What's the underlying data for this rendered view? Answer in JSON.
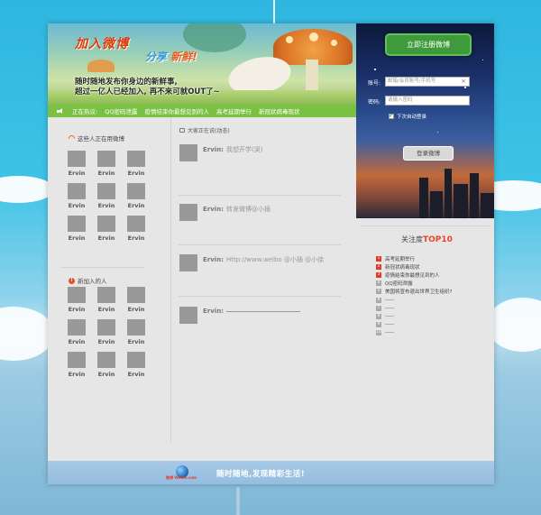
{
  "banner": {
    "title_main": "加入微博",
    "title_sub": "分享",
    "title_sub_highlight": "新鲜!",
    "line1": "随时随地发布你身边的新鲜事,",
    "line2": "超过一亿人已经加入,   再不来可就OUT了~"
  },
  "hotbar": {
    "label": "正在热议:",
    "topics": [
      "QQ密码泄露",
      "疫情结束你最想见到的人",
      "高考延期举行",
      "新冠状病毒现状"
    ]
  },
  "login": {
    "register_button": "立即注册微博",
    "account_label": "账号:",
    "account_placeholder": "邮箱/会员账号/手机号",
    "clear_glyph": "×",
    "password_label": "密码:",
    "password_placeholder": "请输入密码",
    "remember_label": "下次自动登录",
    "login_button": "登录微博"
  },
  "active_users": {
    "title": "这些人正在用微博",
    "users": [
      "Ervin",
      "Ervin",
      "Ervin",
      "Ervin",
      "Ervin",
      "Ervin",
      "Ervin",
      "Ervin",
      "Ervin"
    ]
  },
  "new_users": {
    "title": "新加入的人",
    "users": [
      "Ervin",
      "Ervin",
      "Ervin",
      "Ervin",
      "Ervin",
      "Ervin",
      "Ervin",
      "Ervin",
      "Ervin"
    ]
  },
  "feed": {
    "title": "大家正在说(动态)",
    "items": [
      {
        "author": "Ervin:",
        "text": "我想开学(哭)"
      },
      {
        "author": "Ervin:",
        "text": "转发微博@小插"
      },
      {
        "author": "Ervin:",
        "text": "Http://www.weibo  @小插 @小徐"
      },
      {
        "author": "Ervin:",
        "text": ""
      }
    ]
  },
  "top10": {
    "title_prefix": "关注度",
    "title_highlight": "TOP10",
    "items": [
      {
        "num": "1",
        "text": "高考延期举行",
        "color": "#e03a2a"
      },
      {
        "num": "2",
        "text": "新冠状病毒现状",
        "color": "#e03a2a"
      },
      {
        "num": "3",
        "text": "疫情结束你最想见到的人",
        "color": "#e03a2a"
      },
      {
        "num": "4",
        "text": "QQ密码泄露",
        "color": "#aaaaaa"
      },
      {
        "num": "5",
        "text": "美国将宣布退出世界卫生组织?",
        "color": "#aaaaaa"
      },
      {
        "num": "6",
        "text": "-----",
        "color": "#aaaaaa"
      },
      {
        "num": "7",
        "text": "-----",
        "color": "#aaaaaa"
      },
      {
        "num": "8",
        "text": "-----",
        "color": "#aaaaaa"
      },
      {
        "num": "9",
        "text": "-----",
        "color": "#aaaaaa"
      },
      {
        "num": "10",
        "text": "-----",
        "color": "#aaaaaa"
      }
    ]
  },
  "footer": {
    "logo_text": "微博 Weibo.com",
    "slogan": "随时随地,发现精彩生活!"
  }
}
